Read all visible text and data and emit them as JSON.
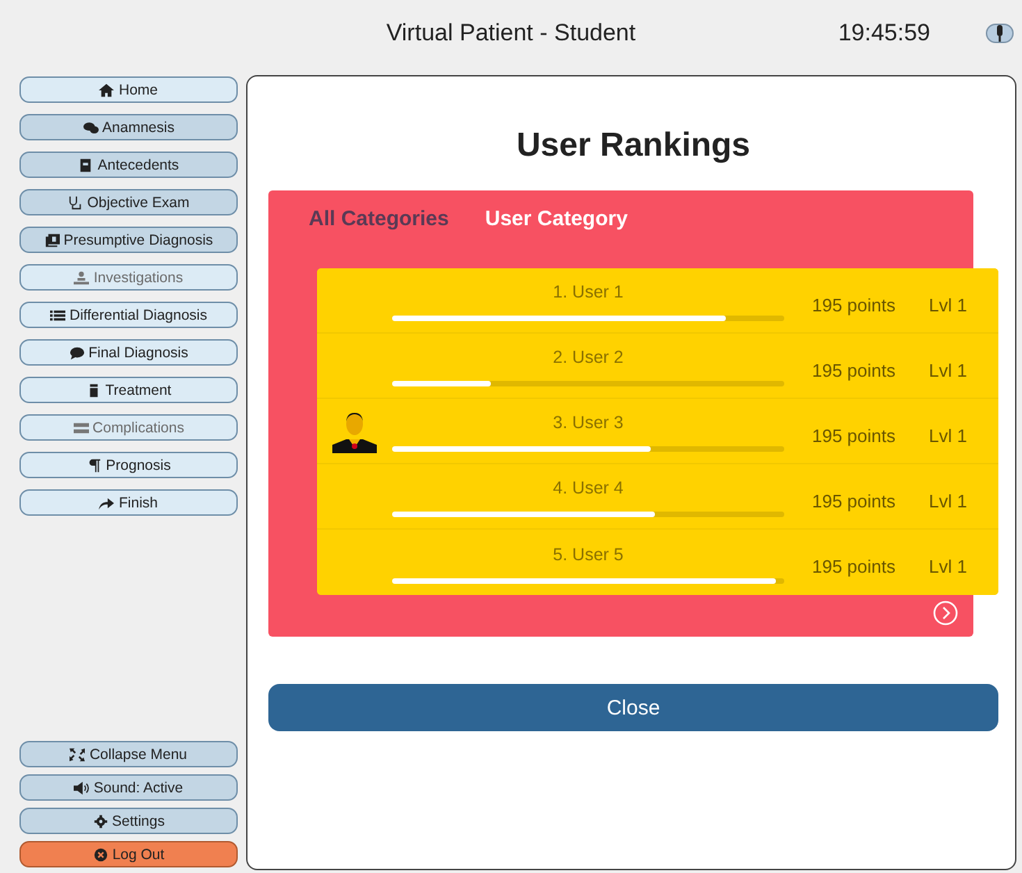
{
  "header": {
    "title": "Virtual Patient - Student",
    "time": "19:45:59"
  },
  "menu": [
    {
      "label": "Home",
      "visited": false,
      "disabled": false
    },
    {
      "label": "Anamnesis",
      "visited": true,
      "disabled": false
    },
    {
      "label": "Antecedents",
      "visited": true,
      "disabled": false
    },
    {
      "label": "Objective Exam",
      "visited": true,
      "disabled": false
    },
    {
      "label": "Presumptive Diagnosis",
      "visited": true,
      "disabled": false
    },
    {
      "label": "Investigations",
      "visited": false,
      "disabled": true
    },
    {
      "label": "Differential Diagnosis",
      "visited": false,
      "disabled": false
    },
    {
      "label": "Final Diagnosis",
      "visited": false,
      "disabled": false
    },
    {
      "label": "Treatment",
      "visited": false,
      "disabled": false
    },
    {
      "label": "Complications",
      "visited": false,
      "disabled": true
    },
    {
      "label": "Prognosis",
      "visited": false,
      "disabled": false
    },
    {
      "label": "Finish",
      "visited": false,
      "disabled": false
    }
  ],
  "bottom_menu": [
    {
      "label": "Collapse Menu",
      "kind": "normal"
    },
    {
      "label": "Sound: Active",
      "kind": "normal"
    },
    {
      "label": "Settings",
      "kind": "normal"
    },
    {
      "label": "Log Out",
      "kind": "danger"
    }
  ],
  "rankings": {
    "title": "User Rankings",
    "tabs": [
      {
        "label": "All Categories",
        "selected": false
      },
      {
        "label": "User Category",
        "selected": true
      }
    ],
    "rows": [
      {
        "name": "1. User 1",
        "level": 0.85,
        "points": "195 points",
        "lvl": "Lvl 1",
        "avatar": false
      },
      {
        "name": "2. User 2",
        "level": 0.25,
        "points": "195 points",
        "lvl": "Lvl 1",
        "avatar": false
      },
      {
        "name": "3. User 3",
        "level": 0.66,
        "points": "195 points",
        "lvl": "Lvl 1",
        "avatar": true
      },
      {
        "name": "4. User 4",
        "level": 0.67,
        "points": "195 points",
        "lvl": "Lvl 1",
        "avatar": false
      },
      {
        "name": "5. User 5",
        "level": 0.98,
        "points": "195 points",
        "lvl": "Lvl 1",
        "avatar": false
      }
    ],
    "close": "Close"
  }
}
